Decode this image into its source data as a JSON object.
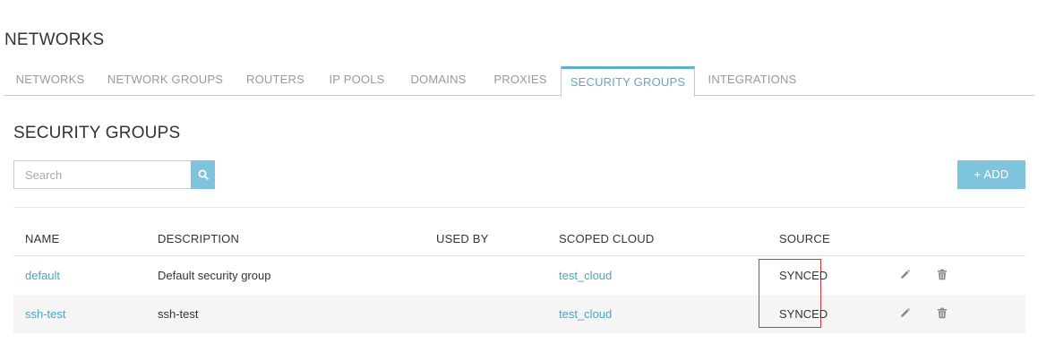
{
  "page": {
    "title": "NETWORKS"
  },
  "tabs": [
    {
      "label": "NETWORKS",
      "active": false
    },
    {
      "label": "NETWORK GROUPS",
      "active": false
    },
    {
      "label": "ROUTERS",
      "active": false
    },
    {
      "label": "IP POOLS",
      "active": false
    },
    {
      "label": "DOMAINS",
      "active": false
    },
    {
      "label": "PROXIES",
      "active": false
    },
    {
      "label": "SECURITY GROUPS",
      "active": true
    },
    {
      "label": "INTEGRATIONS",
      "active": false
    }
  ],
  "section": {
    "title": "SECURITY GROUPS"
  },
  "search": {
    "placeholder": "Search",
    "value": "",
    "icon": "search-icon"
  },
  "toolbar": {
    "add_label": "+ ADD"
  },
  "table": {
    "columns": [
      "NAME",
      "DESCRIPTION",
      "USED BY",
      "SCOPED CLOUD",
      "SOURCE"
    ],
    "rows": [
      {
        "name": "default",
        "description": "Default security group",
        "used_by": "",
        "scoped_cloud": "test_cloud",
        "source": "SYNCED"
      },
      {
        "name": "ssh-test",
        "description": "ssh-test",
        "used_by": "",
        "scoped_cloud": "test_cloud",
        "source": "SYNCED"
      }
    ]
  },
  "colors": {
    "accent": "#7ec4dd",
    "link": "#4aa3c8",
    "active_tab_border": "#5fb0d0",
    "highlight": "#e03030"
  }
}
